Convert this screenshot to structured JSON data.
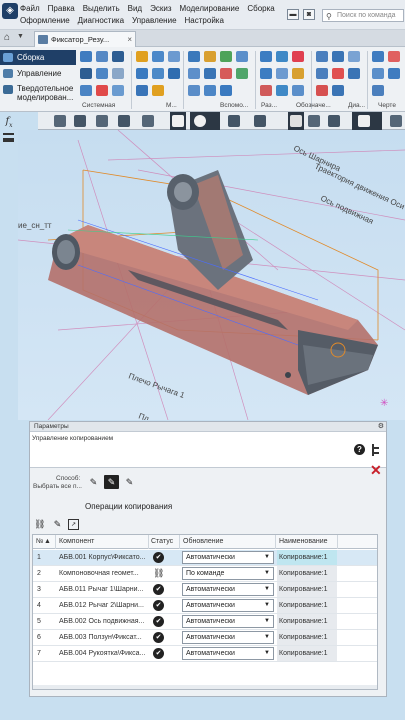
{
  "menu": {
    "row1": [
      "Файл",
      "Правка",
      "Выделить",
      "Вид",
      "Эскиз",
      "Моделирование",
      "Сборка"
    ],
    "row2": [
      "Оформление",
      "Диагностика",
      "Управление",
      "Настройка"
    ],
    "search_placeholder": "Поиск по команда"
  },
  "tabs": {
    "document": "Фиксатор_Резу..."
  },
  "ribbon": {
    "left_items": [
      "Сборка",
      "Управление",
      "Твердотельное моделирован..."
    ],
    "group_labels": [
      "Системная",
      "М...",
      "Вспомо...",
      "Раз...",
      "Обозначе...",
      "Диа...",
      "Черте"
    ]
  },
  "viewport": {
    "labels": [
      "Ось Шарнира",
      "Траектория движения Оси",
      "Ось подвижная",
      "ие_сн_тт",
      "Плечо Рычага 1",
      "Пл"
    ]
  },
  "panel": {
    "header": "Параметры",
    "subtitle": "Управление копированием",
    "method_label": "Способ:",
    "select_all_label": "Выбрать все п...",
    "operations_title": "Операции копирования",
    "table": {
      "headers": [
        "№",
        "Компонент",
        "Статус",
        "Обновление",
        "Наименование"
      ],
      "rows": [
        {
          "n": "1",
          "component": "АБВ.001 Корпус\\Фиксато...",
          "status": "ok",
          "update": "Автоматически",
          "name": "Копирование:1"
        },
        {
          "n": "2",
          "component": "Компоновочная геомет...",
          "status": "link",
          "update": "По команде",
          "name": "Копирование:1"
        },
        {
          "n": "3",
          "component": "АБВ.011 Рычаг 1\\Шарни...",
          "status": "ok",
          "update": "Автоматически",
          "name": "Копирование:1"
        },
        {
          "n": "4",
          "component": "АБВ.012 Рычаг 2\\Шарни...",
          "status": "ok",
          "update": "Автоматически",
          "name": "Копирование:1"
        },
        {
          "n": "5",
          "component": "АБВ.002 Ось подвижная...",
          "status": "ok",
          "update": "Автоматически",
          "name": "Копирование:1"
        },
        {
          "n": "6",
          "component": "АБВ.003 Ползун\\Фиксат...",
          "status": "ok",
          "update": "Автоматически",
          "name": "Копирование:1"
        },
        {
          "n": "7",
          "component": "АБВ.004 Рукоятка\\Фикса...",
          "status": "ok",
          "update": "Автоматически",
          "name": "Копирование:1"
        }
      ]
    }
  },
  "colors": {
    "accent": "#1f3f67",
    "model": "#b4706a",
    "close": "#c8202a"
  }
}
